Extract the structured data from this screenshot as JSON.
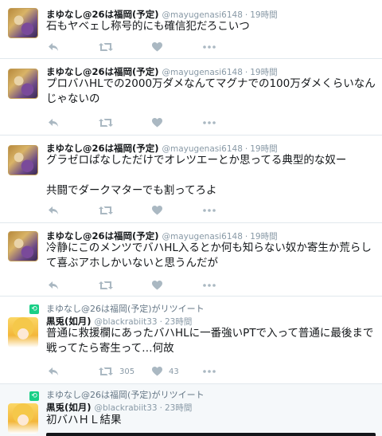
{
  "tweets": [
    {
      "name": "まゆなし@26は福岡(予定)",
      "handle": "@mayugenasi6148",
      "separator": "·",
      "time": "19時間",
      "text": "石もヤベェし称号的にも確信犯だろこいつ"
    },
    {
      "name": "まゆなし@26は福岡(予定)",
      "handle": "@mayugenasi6148",
      "separator": "·",
      "time": "19時間",
      "text": "プロバハHLでの2000万ダメなんてマグナでの100万ダメくらいなんじゃないの"
    },
    {
      "name": "まゆなし@26は福岡(予定)",
      "handle": "@mayugenasi6148",
      "separator": "·",
      "time": "19時間",
      "text": "グラゼロぱなしただけでオレツエーとか思ってる典型的な奴ー\n\n共闘でダークマターでも割ってろよ"
    },
    {
      "name": "まゆなし@26は福岡(予定)",
      "handle": "@mayugenasi6148",
      "separator": "·",
      "time": "19時間",
      "text": "冷静にこのメンツでバハHL入るとか何も知らない奴か寄生か荒らして喜ぶアホしかいないと思うんだが"
    },
    {
      "retweet_label": "まゆなし@26は福岡(予定)がリツイート",
      "name": "黒兎(如月)",
      "handle": "@blackrabiit33",
      "separator": "·",
      "time": "23時間",
      "text": "普通に救援欄にあったバハHLに一番強いPTで入って普通に最後まで戦ってたら寄生って…何故",
      "retweet_count": "305",
      "like_count": "43"
    },
    {
      "retweet_label": "まゆなし@26は福岡(予定)がリツイート",
      "name": "黒兎(如月)",
      "handle": "@blackrabiit33",
      "separator": "·",
      "time": "23時間",
      "text": "初バハＨＬ結果"
    }
  ],
  "icons": {
    "reply": "reply-icon",
    "retweet": "retweet-icon",
    "like": "heart-icon",
    "more": "more-icon"
  },
  "colors": {
    "text": "#14171a",
    "muted": "#8899a6",
    "icon": "#aab8c2",
    "retweet_green": "#19cf86",
    "border": "#e1e8ed"
  }
}
